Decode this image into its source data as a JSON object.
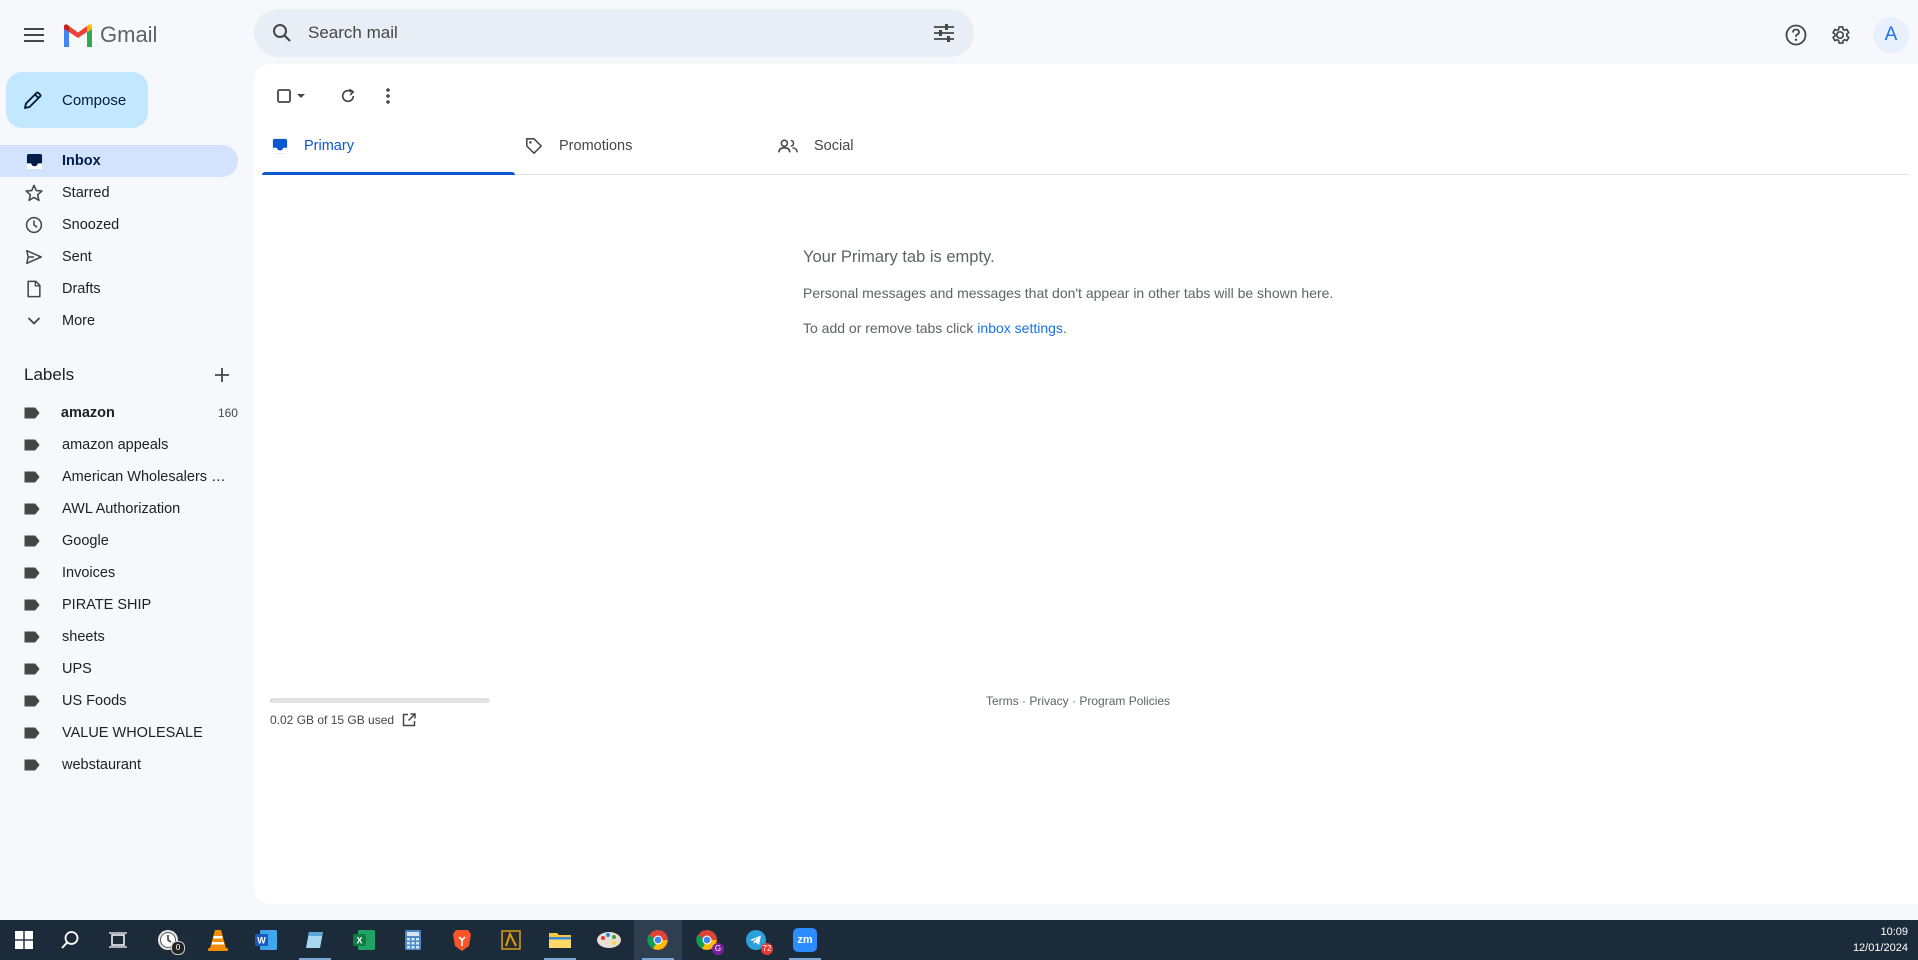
{
  "app": {
    "name": "Gmail"
  },
  "search": {
    "placeholder": "Search mail"
  },
  "header": {
    "avatar_initial": "A"
  },
  "compose": {
    "label": "Compose"
  },
  "nav": [
    {
      "label": "Inbox",
      "icon": "inbox-icon",
      "active": true
    },
    {
      "label": "Starred",
      "icon": "star-icon"
    },
    {
      "label": "Snoozed",
      "icon": "clock-icon"
    },
    {
      "label": "Sent",
      "icon": "send-icon"
    },
    {
      "label": "Drafts",
      "icon": "draft-icon"
    },
    {
      "label": "More",
      "icon": "chevron-down-icon"
    }
  ],
  "labels": {
    "title": "Labels",
    "items": [
      {
        "name": "amazon",
        "count": "160",
        "bold": true
      },
      {
        "name": "amazon appeals"
      },
      {
        "name": "American Wholesalers L..."
      },
      {
        "name": "AWL Authorization"
      },
      {
        "name": "Google"
      },
      {
        "name": "Invoices"
      },
      {
        "name": "PIRATE SHIP"
      },
      {
        "name": "sheets"
      },
      {
        "name": "UPS"
      },
      {
        "name": "US Foods"
      },
      {
        "name": "VALUE WHOLESALE"
      },
      {
        "name": "webstaurant"
      }
    ]
  },
  "tabs": [
    {
      "label": "Primary",
      "icon": "inbox-icon",
      "active": true
    },
    {
      "label": "Promotions",
      "icon": "tag-icon"
    },
    {
      "label": "Social",
      "icon": "people-icon"
    }
  ],
  "empty": {
    "title": "Your Primary tab is empty.",
    "line1": "Personal messages and messages that don't appear in other tabs will be shown here.",
    "line2_prefix": "To add or remove tabs click ",
    "line2_link": "inbox settings",
    "line2_suffix": "."
  },
  "storage": {
    "text": "0.02 GB of 15 GB used",
    "used_fraction": 0.0013
  },
  "footer": {
    "terms": "Terms",
    "privacy": "Privacy",
    "policies": "Program Policies",
    "sep": " · "
  },
  "taskbar": {
    "apps": [
      {
        "name": "start-button"
      },
      {
        "name": "search-button"
      },
      {
        "name": "task-view-button"
      },
      {
        "name": "clock-app",
        "badge": "0"
      },
      {
        "name": "vlc"
      },
      {
        "name": "word"
      },
      {
        "name": "notepad"
      },
      {
        "name": "excel"
      },
      {
        "name": "calculator"
      },
      {
        "name": "brave"
      },
      {
        "name": "sketch-app"
      },
      {
        "name": "file-explorer",
        "open": true
      },
      {
        "name": "paint-app"
      },
      {
        "name": "chrome",
        "open": true,
        "focused": true
      },
      {
        "name": "chrome-profile",
        "badge": "G"
      },
      {
        "name": "telegram",
        "badge": "72"
      },
      {
        "name": "zoom",
        "label": "zm",
        "open": true
      }
    ],
    "time": "10:09",
    "date": "12/01/2024"
  },
  "colors": {
    "accent": "#0b57d0",
    "compose_bg": "#c2e7ff",
    "active_nav_bg": "#d3e3fd",
    "page_bg": "#f6f8fc",
    "taskbar_bg": "#1c2b3a"
  }
}
